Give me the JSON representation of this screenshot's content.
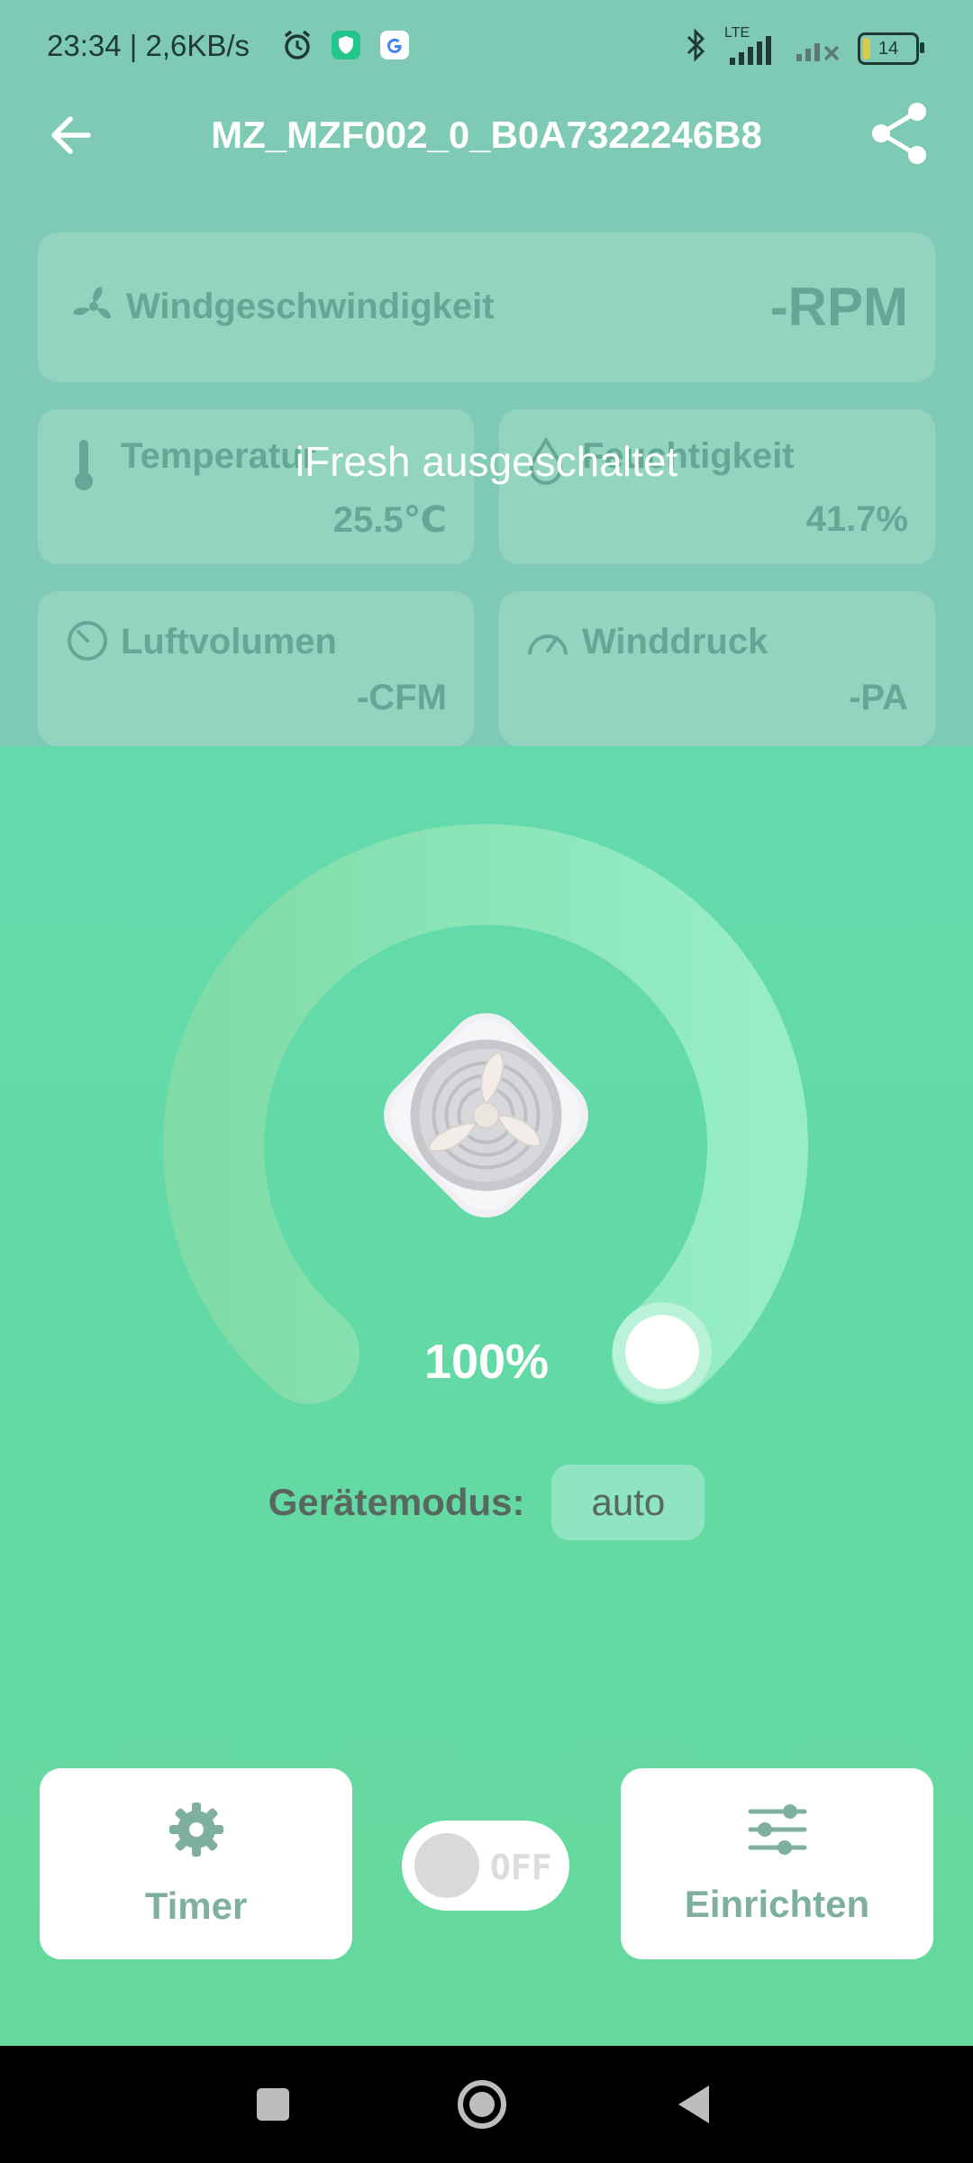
{
  "status_bar": {
    "time": "23:34 | 2,6KB/s",
    "network": "LTE",
    "battery": "14",
    "battery_level": 0.14
  },
  "app_bar": {
    "title": "MZ_MZF002_0_B0A7322246B8",
    "back_icon": "arrow-left-icon",
    "share_icon": "share-icon"
  },
  "metrics": {
    "wind_speed": {
      "label": "Windgeschwindigkeit",
      "value": "-RPM",
      "icon": "fan-icon"
    },
    "temperature": {
      "label": "Temperatur",
      "value": "25.5℃",
      "icon": "thermometer-icon"
    },
    "humidity": {
      "label": "Feuchtigkeit",
      "value": "41.7%",
      "icon": "droplet-icon"
    },
    "air_volume": {
      "label": "Luftvolumen",
      "value": "-CFM",
      "icon": "gauge-icon"
    },
    "wind_pressure": {
      "label": "Winddruck",
      "value": "-PA",
      "icon": "speedometer-icon"
    }
  },
  "overlay_message": "iFresh ausgeschaltet",
  "dial": {
    "percent": "100%",
    "level": 1.0
  },
  "mode": {
    "label": "Gerätemodus:",
    "value": "auto"
  },
  "controls": {
    "timer_label": "Timer",
    "setup_label": "Einrichten",
    "power_toggle_label": "OFF",
    "power_on": false
  },
  "colors": {
    "accent_green": "#63d9a6",
    "overlay": "#7fcab5",
    "card": "#93d4c0",
    "button_text": "#7fb09f"
  }
}
